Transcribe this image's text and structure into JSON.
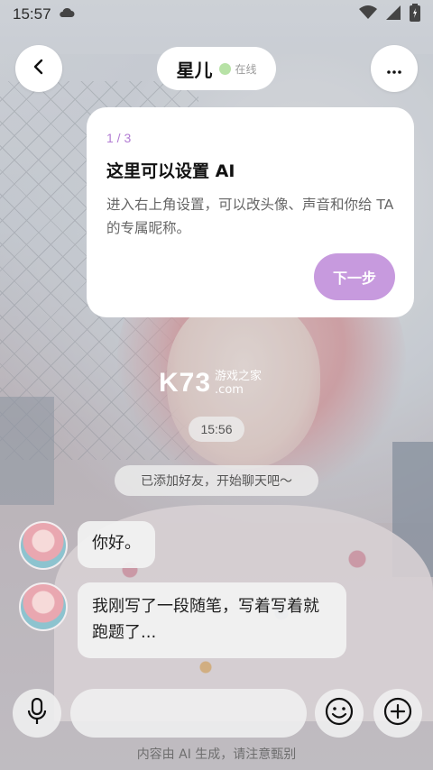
{
  "status_bar": {
    "time": "15:57",
    "cloud_icon": "cloud-icon",
    "wifi_icon": "wifi-icon",
    "signal_icon": "signal-icon",
    "battery_icon": "battery-icon"
  },
  "header": {
    "name": "星儿",
    "online_status": "在线",
    "online_color": "#b7e2a6",
    "back_icon": "chevron-left-icon",
    "more_icon": "more-dots-icon"
  },
  "guide": {
    "step": "1 / 3",
    "title": "这里可以设置 AI",
    "description": "进入右上角设置，可以改头像、声音和你给 TA 的专属昵称。",
    "next_label": "下一步",
    "accent": "#c79ade"
  },
  "watermark": {
    "brand": "K73",
    "sub1": "游戏之家",
    "sub2": ".com"
  },
  "chat": {
    "timestamp": "15:56",
    "system_message": "已添加好友，开始聊天吧～",
    "messages": [
      {
        "text": "你好。"
      },
      {
        "text": "我刚写了一段随笔，写着写着就跑题了..."
      }
    ]
  },
  "input_bar": {
    "mic_icon": "microphone-icon",
    "emoji_icon": "emoji-icon",
    "plus_icon": "plus-icon"
  },
  "disclaimer": "内容由 AI 生成，请注意甄别"
}
